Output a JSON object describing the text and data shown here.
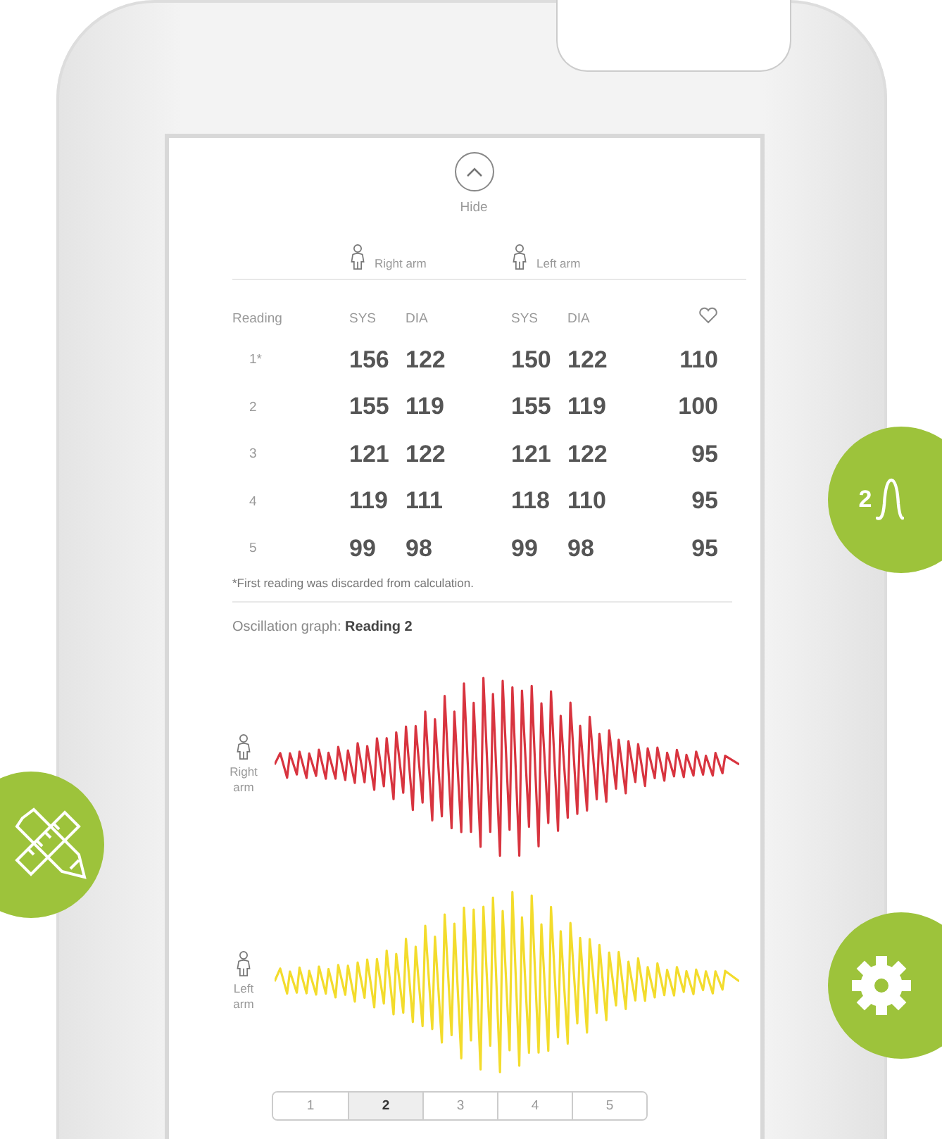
{
  "hide_button": {
    "label": "Hide"
  },
  "arms": [
    {
      "label": "Right arm"
    },
    {
      "label": "Left arm"
    }
  ],
  "table": {
    "columns": [
      "Reading",
      "SYS",
      "DIA",
      "SYS",
      "DIA"
    ],
    "rows": [
      {
        "reading": "1*",
        "values": [
          "156",
          "122",
          "150",
          "122",
          "110"
        ]
      },
      {
        "reading": "2",
        "values": [
          "155",
          "119",
          "155",
          "119",
          "100"
        ]
      },
      {
        "reading": "3",
        "values": [
          "121",
          "122",
          "121",
          "122",
          "95"
        ]
      },
      {
        "reading": "4",
        "values": [
          "119",
          "111",
          "118",
          "110",
          "95"
        ]
      },
      {
        "reading": "5",
        "values": [
          "99",
          "98",
          "99",
          "98",
          "95"
        ]
      }
    ]
  },
  "footnote": "*First reading was discarded from calculation.",
  "oscillation_title": "Oscillation graph: **Reading 2**",
  "graphs": [
    {
      "label": "Right arm",
      "color": "#d8343f"
    },
    {
      "label": "Left arm",
      "color": "#f3dc2c"
    }
  ],
  "pages": [
    {
      "label": "1",
      "selected": false
    },
    {
      "label": "2",
      "selected": true
    },
    {
      "label": "3",
      "selected": false
    },
    {
      "label": "4",
      "selected": false
    },
    {
      "label": "5",
      "selected": false
    }
  ],
  "side_buttons": [
    {
      "kind": "wave",
      "label": "2"
    },
    {
      "kind": "tools"
    },
    {
      "kind": "gear"
    }
  ]
}
